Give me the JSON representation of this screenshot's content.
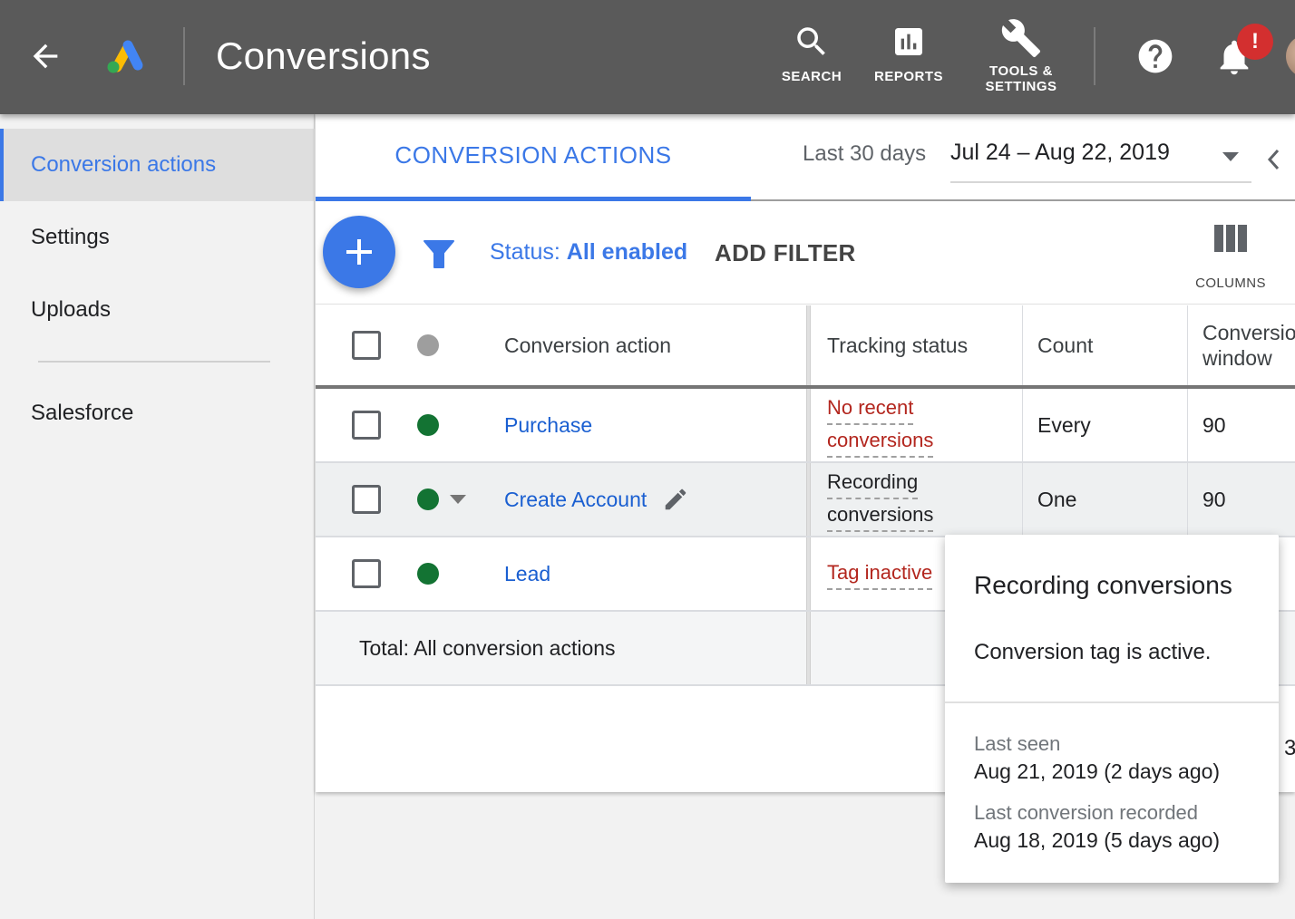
{
  "header": {
    "title": "Conversions",
    "nav": [
      {
        "label": "SEARCH",
        "icon": "search-icon"
      },
      {
        "label": "REPORTS",
        "icon": "reports-icon"
      },
      {
        "label_line1": "TOOLS &",
        "label_line2": "SETTINGS",
        "icon": "wrench-icon"
      }
    ],
    "alert_badge": "!",
    "colors": {
      "bar": "#5a5a5a",
      "alert": "#d32f2f"
    }
  },
  "sidebar": {
    "items": [
      {
        "label": "Conversion actions",
        "active": true
      },
      {
        "label": "Settings"
      },
      {
        "label": "Uploads"
      },
      {
        "label": "Salesforce"
      }
    ]
  },
  "tabs": {
    "active": "CONVERSION ACTIONS"
  },
  "date": {
    "range_label": "Last 30 days",
    "value": "Jul 24 – Aug 22, 2019"
  },
  "toolbar": {
    "status_prefix": "Status:",
    "status_value": "All enabled",
    "add_filter": "ADD FILTER",
    "columns": "COLUMNS"
  },
  "table": {
    "headers": {
      "action": "Conversion action",
      "tracking": "Tracking status",
      "count": "Count",
      "window_line1": "Conversion",
      "window_line2": "window"
    },
    "rows": [
      {
        "name": "Purchase",
        "status_line1": "No recent",
        "status_line2": "conversions",
        "count": "Every",
        "window": "90"
      },
      {
        "name": "Create Account",
        "status_line1": "Recording",
        "status_line2": "conversions",
        "count": "One",
        "window": "90"
      },
      {
        "name": "Lead",
        "status_line1": "Tag inactive",
        "count": "",
        "window": ""
      }
    ],
    "total_label": "Total: All conversion actions",
    "edge_value": "3"
  },
  "popup": {
    "title": "Recording conversions",
    "description": "Conversion tag is active.",
    "last_seen_label": "Last seen",
    "last_seen_value": "Aug 21, 2019 (2 days ago)",
    "last_recorded_label": "Last conversion recorded",
    "last_recorded_value": "Aug 18, 2019 (5 days ago)"
  },
  "colors": {
    "accent": "#3b78e7",
    "status_error": "#b3261e",
    "status_enabled": "#137333"
  }
}
